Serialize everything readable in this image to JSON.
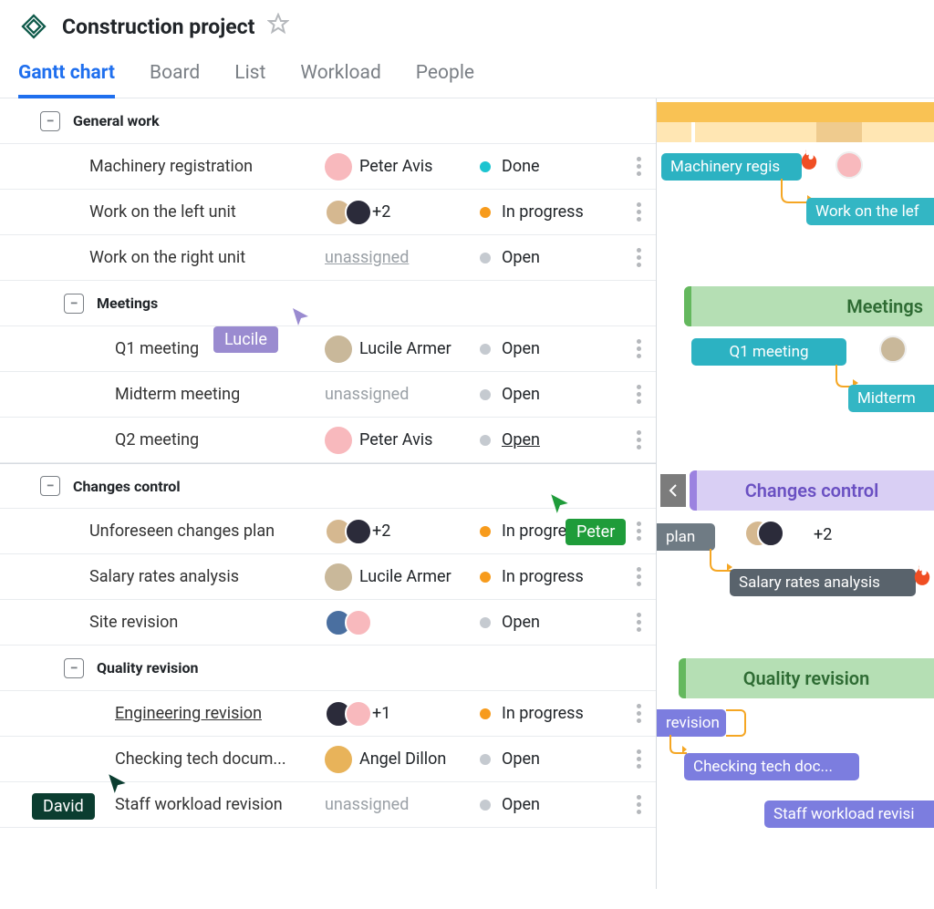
{
  "header": {
    "title": "Construction project"
  },
  "tabs": {
    "gantt": "Gantt chart",
    "board": "Board",
    "list": "List",
    "workload": "Workload",
    "people": "People"
  },
  "groups": {
    "general": "General work",
    "meetings": "Meetings",
    "changes": "Changes control",
    "quality": "Quality revision"
  },
  "tasks": {
    "machinery": {
      "name": "Machinery registration",
      "assignee": "Peter Avis",
      "status": "Done"
    },
    "left_unit": {
      "name": "Work on the left unit",
      "assignee_extra": "+2",
      "status": "In progress"
    },
    "right_unit": {
      "name": "Work on the right unit",
      "assignee": "unassigned",
      "status": "Open"
    },
    "q1": {
      "name": "Q1 meeting",
      "assignee": "Lucile Armer",
      "status": "Open"
    },
    "midterm": {
      "name": "Midterm meeting",
      "assignee": "unassigned",
      "status": "Open"
    },
    "q2": {
      "name": "Q2 meeting",
      "assignee": "Peter Avis",
      "status": "Open"
    },
    "unforeseen": {
      "name": "Unforeseen changes plan",
      "assignee_extra": "+2",
      "status": "In progress"
    },
    "salary": {
      "name": "Salary rates analysis",
      "assignee": "Lucile Armer",
      "status": "In progress"
    },
    "site": {
      "name": "Site revision",
      "status": "Open"
    },
    "engineering": {
      "name": "Engineering revision",
      "assignee_extra": "+1",
      "status": "In progress"
    },
    "checking": {
      "name": "Checking tech docum...",
      "assignee": "Angel Dillon",
      "status": "Open"
    },
    "staff": {
      "name": "Staff workload revision",
      "assignee": "unassigned",
      "status": "Open"
    }
  },
  "gantt": {
    "bars": {
      "machinery": "Machinery regis",
      "left_unit": "Work on the lef",
      "q1": "Q1 meeting",
      "midterm": "Midterm",
      "plan": "plan",
      "plan_extra": "+2",
      "salary": "Salary rates analysis",
      "revision": "revision",
      "checking": "Checking tech doc...",
      "staff": "Staff workload revisi"
    },
    "sections": {
      "meetings": "Meetings",
      "changes": "Changes control",
      "quality": "Quality revision"
    }
  },
  "cursors": {
    "lucile": "Lucile",
    "peter": "Peter",
    "david": "David"
  }
}
